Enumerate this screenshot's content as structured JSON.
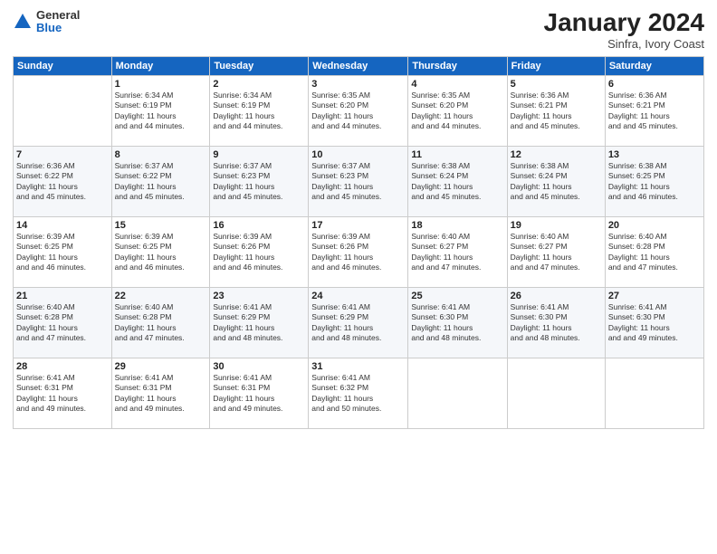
{
  "header": {
    "logo_general": "General",
    "logo_blue": "Blue",
    "month_title": "January 2024",
    "subtitle": "Sinfra, Ivory Coast"
  },
  "weekdays": [
    "Sunday",
    "Monday",
    "Tuesday",
    "Wednesday",
    "Thursday",
    "Friday",
    "Saturday"
  ],
  "weeks": [
    [
      {
        "day": "",
        "sunrise": "",
        "sunset": "",
        "daylight": ""
      },
      {
        "day": "1",
        "sunrise": "Sunrise: 6:34 AM",
        "sunset": "Sunset: 6:19 PM",
        "daylight": "Daylight: 11 hours and 44 minutes."
      },
      {
        "day": "2",
        "sunrise": "Sunrise: 6:34 AM",
        "sunset": "Sunset: 6:19 PM",
        "daylight": "Daylight: 11 hours and 44 minutes."
      },
      {
        "day": "3",
        "sunrise": "Sunrise: 6:35 AM",
        "sunset": "Sunset: 6:20 PM",
        "daylight": "Daylight: 11 hours and 44 minutes."
      },
      {
        "day": "4",
        "sunrise": "Sunrise: 6:35 AM",
        "sunset": "Sunset: 6:20 PM",
        "daylight": "Daylight: 11 hours and 44 minutes."
      },
      {
        "day": "5",
        "sunrise": "Sunrise: 6:36 AM",
        "sunset": "Sunset: 6:21 PM",
        "daylight": "Daylight: 11 hours and 45 minutes."
      },
      {
        "day": "6",
        "sunrise": "Sunrise: 6:36 AM",
        "sunset": "Sunset: 6:21 PM",
        "daylight": "Daylight: 11 hours and 45 minutes."
      }
    ],
    [
      {
        "day": "7",
        "sunrise": "Sunrise: 6:36 AM",
        "sunset": "Sunset: 6:22 PM",
        "daylight": "Daylight: 11 hours and 45 minutes."
      },
      {
        "day": "8",
        "sunrise": "Sunrise: 6:37 AM",
        "sunset": "Sunset: 6:22 PM",
        "daylight": "Daylight: 11 hours and 45 minutes."
      },
      {
        "day": "9",
        "sunrise": "Sunrise: 6:37 AM",
        "sunset": "Sunset: 6:23 PM",
        "daylight": "Daylight: 11 hours and 45 minutes."
      },
      {
        "day": "10",
        "sunrise": "Sunrise: 6:37 AM",
        "sunset": "Sunset: 6:23 PM",
        "daylight": "Daylight: 11 hours and 45 minutes."
      },
      {
        "day": "11",
        "sunrise": "Sunrise: 6:38 AM",
        "sunset": "Sunset: 6:24 PM",
        "daylight": "Daylight: 11 hours and 45 minutes."
      },
      {
        "day": "12",
        "sunrise": "Sunrise: 6:38 AM",
        "sunset": "Sunset: 6:24 PM",
        "daylight": "Daylight: 11 hours and 45 minutes."
      },
      {
        "day": "13",
        "sunrise": "Sunrise: 6:38 AM",
        "sunset": "Sunset: 6:25 PM",
        "daylight": "Daylight: 11 hours and 46 minutes."
      }
    ],
    [
      {
        "day": "14",
        "sunrise": "Sunrise: 6:39 AM",
        "sunset": "Sunset: 6:25 PM",
        "daylight": "Daylight: 11 hours and 46 minutes."
      },
      {
        "day": "15",
        "sunrise": "Sunrise: 6:39 AM",
        "sunset": "Sunset: 6:25 PM",
        "daylight": "Daylight: 11 hours and 46 minutes."
      },
      {
        "day": "16",
        "sunrise": "Sunrise: 6:39 AM",
        "sunset": "Sunset: 6:26 PM",
        "daylight": "Daylight: 11 hours and 46 minutes."
      },
      {
        "day": "17",
        "sunrise": "Sunrise: 6:39 AM",
        "sunset": "Sunset: 6:26 PM",
        "daylight": "Daylight: 11 hours and 46 minutes."
      },
      {
        "day": "18",
        "sunrise": "Sunrise: 6:40 AM",
        "sunset": "Sunset: 6:27 PM",
        "daylight": "Daylight: 11 hours and 47 minutes."
      },
      {
        "day": "19",
        "sunrise": "Sunrise: 6:40 AM",
        "sunset": "Sunset: 6:27 PM",
        "daylight": "Daylight: 11 hours and 47 minutes."
      },
      {
        "day": "20",
        "sunrise": "Sunrise: 6:40 AM",
        "sunset": "Sunset: 6:28 PM",
        "daylight": "Daylight: 11 hours and 47 minutes."
      }
    ],
    [
      {
        "day": "21",
        "sunrise": "Sunrise: 6:40 AM",
        "sunset": "Sunset: 6:28 PM",
        "daylight": "Daylight: 11 hours and 47 minutes."
      },
      {
        "day": "22",
        "sunrise": "Sunrise: 6:40 AM",
        "sunset": "Sunset: 6:28 PM",
        "daylight": "Daylight: 11 hours and 47 minutes."
      },
      {
        "day": "23",
        "sunrise": "Sunrise: 6:41 AM",
        "sunset": "Sunset: 6:29 PM",
        "daylight": "Daylight: 11 hours and 48 minutes."
      },
      {
        "day": "24",
        "sunrise": "Sunrise: 6:41 AM",
        "sunset": "Sunset: 6:29 PM",
        "daylight": "Daylight: 11 hours and 48 minutes."
      },
      {
        "day": "25",
        "sunrise": "Sunrise: 6:41 AM",
        "sunset": "Sunset: 6:30 PM",
        "daylight": "Daylight: 11 hours and 48 minutes."
      },
      {
        "day": "26",
        "sunrise": "Sunrise: 6:41 AM",
        "sunset": "Sunset: 6:30 PM",
        "daylight": "Daylight: 11 hours and 48 minutes."
      },
      {
        "day": "27",
        "sunrise": "Sunrise: 6:41 AM",
        "sunset": "Sunset: 6:30 PM",
        "daylight": "Daylight: 11 hours and 49 minutes."
      }
    ],
    [
      {
        "day": "28",
        "sunrise": "Sunrise: 6:41 AM",
        "sunset": "Sunset: 6:31 PM",
        "daylight": "Daylight: 11 hours and 49 minutes."
      },
      {
        "day": "29",
        "sunrise": "Sunrise: 6:41 AM",
        "sunset": "Sunset: 6:31 PM",
        "daylight": "Daylight: 11 hours and 49 minutes."
      },
      {
        "day": "30",
        "sunrise": "Sunrise: 6:41 AM",
        "sunset": "Sunset: 6:31 PM",
        "daylight": "Daylight: 11 hours and 49 minutes."
      },
      {
        "day": "31",
        "sunrise": "Sunrise: 6:41 AM",
        "sunset": "Sunset: 6:32 PM",
        "daylight": "Daylight: 11 hours and 50 minutes."
      },
      {
        "day": "",
        "sunrise": "",
        "sunset": "",
        "daylight": ""
      },
      {
        "day": "",
        "sunrise": "",
        "sunset": "",
        "daylight": ""
      },
      {
        "day": "",
        "sunrise": "",
        "sunset": "",
        "daylight": ""
      }
    ]
  ]
}
